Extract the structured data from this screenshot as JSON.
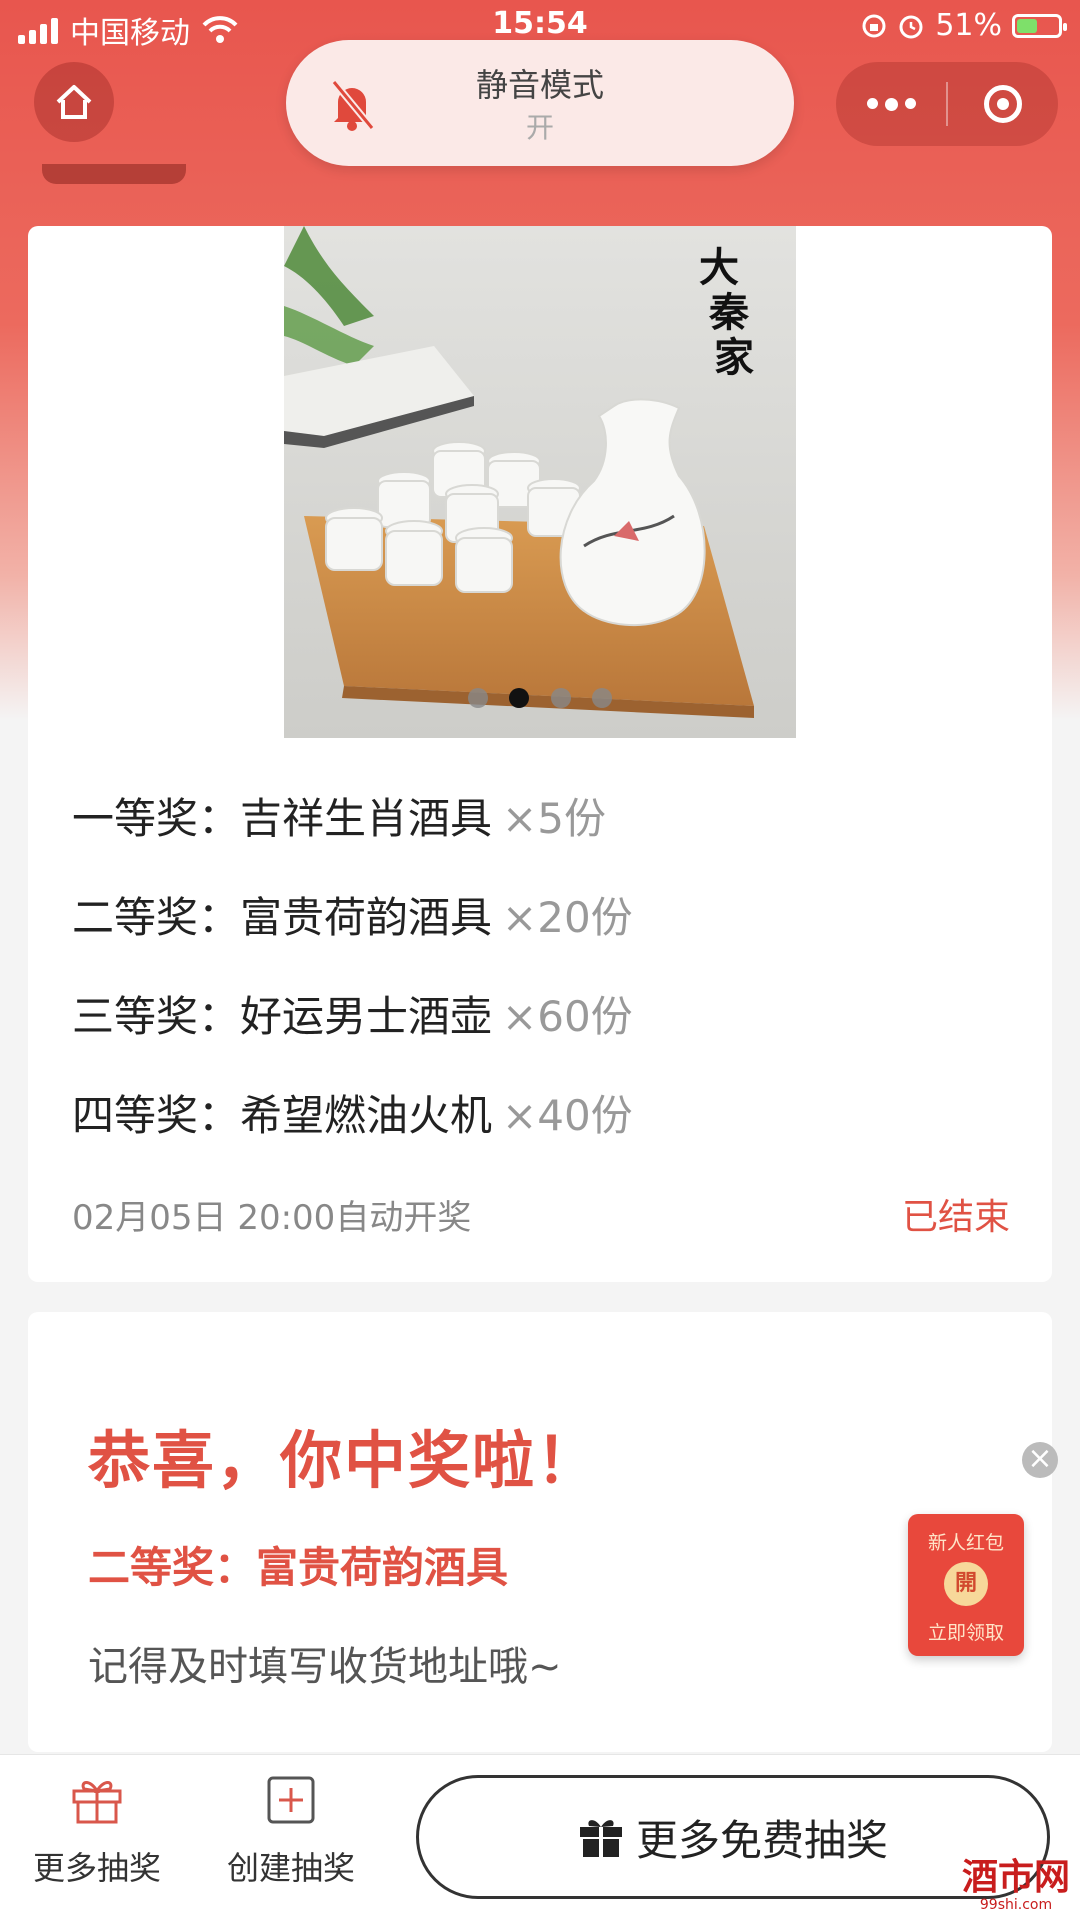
{
  "status_bar": {
    "carrier": "中国移动",
    "time": "15:54",
    "battery": "51%",
    "battery_level": 0.51
  },
  "top_nav": {
    "home_icon": "home-icon",
    "mute_title": "静音模式",
    "mute_state": "开",
    "more_icon": "more-dots-icon",
    "target_icon": "target-icon"
  },
  "prize_card": {
    "brand_mark": "大秦家",
    "carousel_total": 4,
    "carousel_active": 2,
    "prizes": [
      {
        "rank": "一等奖：",
        "name": "吉祥生肖酒具",
        "qty": "×5份"
      },
      {
        "rank": "二等奖：",
        "name": "富贵荷韵酒具",
        "qty": "×20份"
      },
      {
        "rank": "三等奖：",
        "name": "好运男士酒壶",
        "qty": "×60份"
      },
      {
        "rank": "四等奖：",
        "name": "希望燃油火机",
        "qty": "×40份"
      }
    ],
    "draw_time": "02月05日 20:00自动开奖",
    "status": "已结束"
  },
  "win_card": {
    "congrats": "恭喜，你中奖啦！",
    "won_prize": "二等奖：富贵荷韵酒具",
    "reminder": "记得及时填写收货地址哦~"
  },
  "red_packet": {
    "close": "×",
    "title": "新人红包",
    "coin": "開",
    "action": "立即领取"
  },
  "bottom_bar": {
    "more_draws": "更多抽奖",
    "create_draw": "创建抽奖",
    "more_free": "更多免费抽奖"
  },
  "watermark": {
    "name": "酒市网",
    "domain": "99shi.com"
  },
  "colors": {
    "accent": "#e05244",
    "header_red": "#e8564e"
  }
}
